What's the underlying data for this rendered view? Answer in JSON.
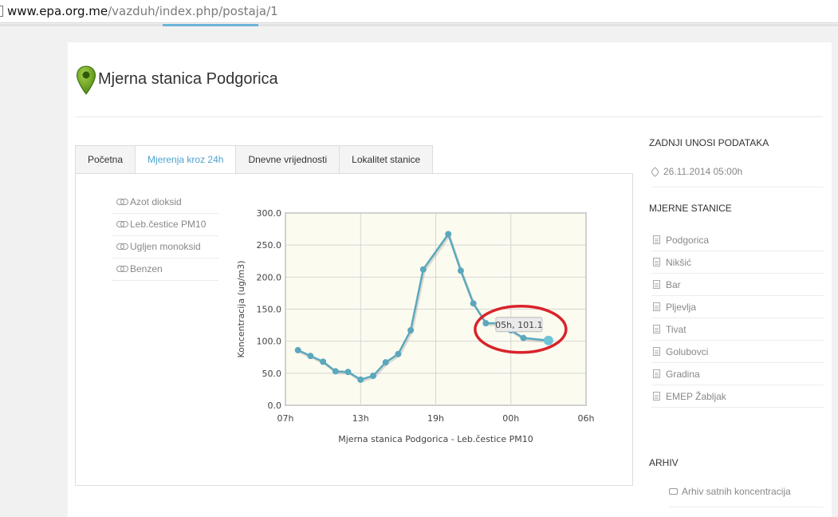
{
  "browser": {
    "url_host": "www.epa.org.me",
    "url_path": "/vazduh/index.php/postaja/1"
  },
  "page": {
    "title": "Mjerna stanica Podgorica",
    "icon": "map-pin-icon",
    "accent_color": "#4fa3cf"
  },
  "tabs": [
    {
      "label": "Početna"
    },
    {
      "label": "Mjerenja kroz 24h"
    },
    {
      "label": "Dnevne vrijednosti"
    },
    {
      "label": "Lokalitet stanice"
    }
  ],
  "pollutants": [
    {
      "label": "Azot dioksid"
    },
    {
      "label": "Leb.čestice PM10"
    },
    {
      "label": "Ugljen monoksid"
    },
    {
      "label": "Benzen"
    }
  ],
  "sidebar": {
    "latest_heading": "ZADNJI UNOSI PODATAKA",
    "latest_date": "26.11.2014 05:00h",
    "stations_heading": "MJERNE STANICE",
    "stations": [
      {
        "label": "Podgorica"
      },
      {
        "label": "Nikšić"
      },
      {
        "label": "Bar"
      },
      {
        "label": "Pljevlja"
      },
      {
        "label": "Tivat"
      },
      {
        "label": "Golubovci"
      },
      {
        "label": "Gradina"
      },
      {
        "label": "EMEP Žabljak"
      }
    ],
    "archive_heading": "ARHIV",
    "archive_link": "Arhiv satnih koncentracija"
  },
  "chart_data": {
    "type": "line",
    "xlabel": "Mjerna stanica Podgorica - Leb.čestice PM10",
    "ylabel": "Koncentracija (ug/m3)",
    "ylim": [
      0,
      300
    ],
    "y_ticks": [
      "0.0",
      "50.0",
      "100.0",
      "150.0",
      "200.0",
      "250.0",
      "300.0"
    ],
    "x_ticks": [
      {
        "label": "07h",
        "hour": 7
      },
      {
        "label": "13h",
        "hour": 13
      },
      {
        "label": "19h",
        "hour": 19
      },
      {
        "label": "00h",
        "hour": 25
      },
      {
        "label": "06h",
        "hour": 31
      }
    ],
    "xlim": [
      7,
      31
    ],
    "grid": true,
    "line_color": "#5ba8bd",
    "background_color": "#fcfbf0",
    "points": [
      {
        "hour": 8,
        "value": 86
      },
      {
        "hour": 9,
        "value": 77
      },
      {
        "hour": 10,
        "value": 68
      },
      {
        "hour": 11,
        "value": 53
      },
      {
        "hour": 12,
        "value": 52
      },
      {
        "hour": 13,
        "value": 40
      },
      {
        "hour": 14,
        "value": 46
      },
      {
        "hour": 15,
        "value": 67
      },
      {
        "hour": 16,
        "value": 80
      },
      {
        "hour": 17,
        "value": 117
      },
      {
        "hour": 18,
        "value": 212
      },
      {
        "hour": 20,
        "value": 267
      },
      {
        "hour": 21,
        "value": 210
      },
      {
        "hour": 22,
        "value": 159
      },
      {
        "hour": 23,
        "value": 128
      },
      {
        "hour": 24,
        "value": 128
      },
      {
        "hour": 25,
        "value": 117
      },
      {
        "hour": 26,
        "value": 105
      },
      {
        "hour": 28,
        "value": 101.1
      }
    ],
    "tooltip": "05h, 101.1",
    "highlight_color": "#d9232a"
  }
}
